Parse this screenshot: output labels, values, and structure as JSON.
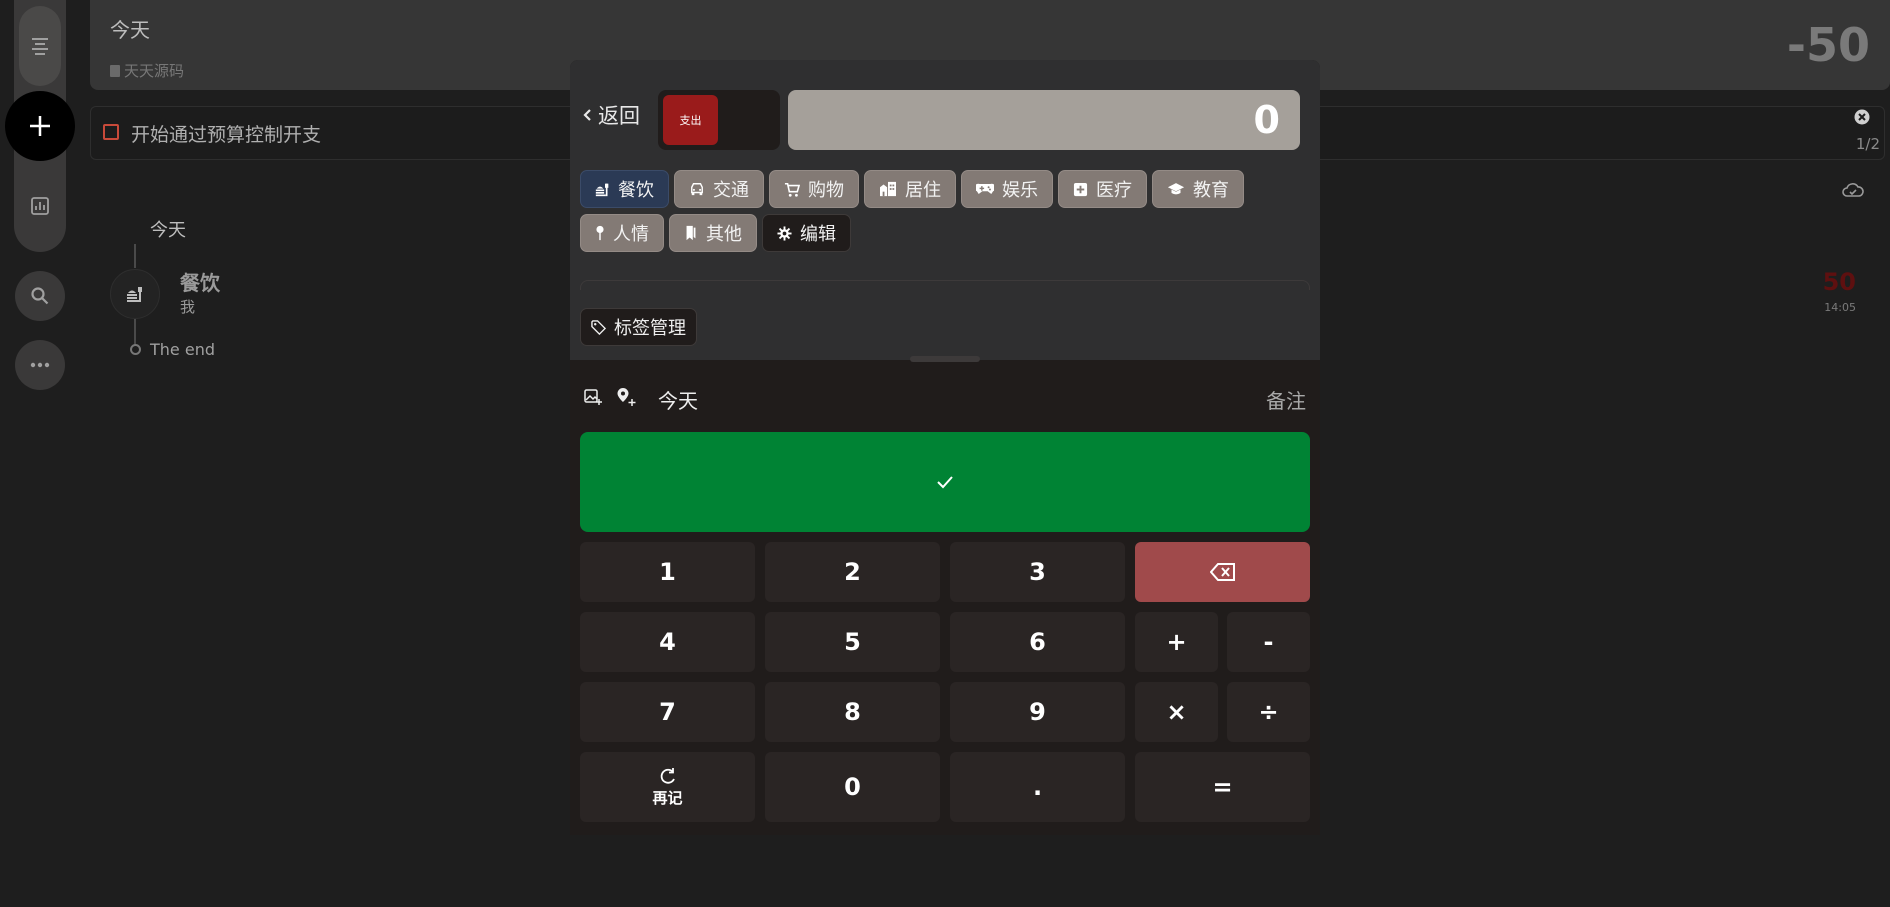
{
  "summary": {
    "title": "今天",
    "source": "天天源码",
    "total": "-50"
  },
  "notice": {
    "text": "开始通过预算控制开支",
    "page": "1/2"
  },
  "timeline": {
    "date": "今天",
    "entry": {
      "category": "餐饮",
      "member": "我",
      "amount": "50",
      "time": "14:05"
    },
    "end": "The end"
  },
  "modal": {
    "back_label": "返回",
    "type_label": "支出",
    "amount": "0",
    "categories": [
      {
        "label": "餐饮",
        "icon": "food-icon",
        "active": true
      },
      {
        "label": "交通",
        "icon": "car-icon"
      },
      {
        "label": "购物",
        "icon": "cart-icon"
      },
      {
        "label": "居住",
        "icon": "building-icon"
      },
      {
        "label": "娱乐",
        "icon": "gamepad-icon"
      },
      {
        "label": "医疗",
        "icon": "medical-icon"
      },
      {
        "label": "教育",
        "icon": "graduation-icon"
      },
      {
        "label": "人情",
        "icon": "pin-icon"
      },
      {
        "label": "其他",
        "icon": "bookmark-icon"
      },
      {
        "label": "编辑",
        "icon": "gear-icon"
      }
    ],
    "tag_manage_label": "标签管理",
    "date_label": "今天",
    "note_label": "备注",
    "keypad": {
      "k1": "1",
      "k2": "2",
      "k3": "3",
      "k4": "4",
      "k5": "5",
      "k6": "6",
      "k7": "7",
      "k8": "8",
      "k9": "9",
      "k0": "0",
      "dot": ".",
      "plus": "+",
      "minus": "-",
      "times": "×",
      "divide": "÷",
      "equals": "=",
      "again": "再记"
    }
  },
  "colors": {
    "income_type": "#9a1b1b",
    "confirm": "#008334",
    "backspace": "#a04a4b",
    "active_category": "#2b3a55"
  }
}
